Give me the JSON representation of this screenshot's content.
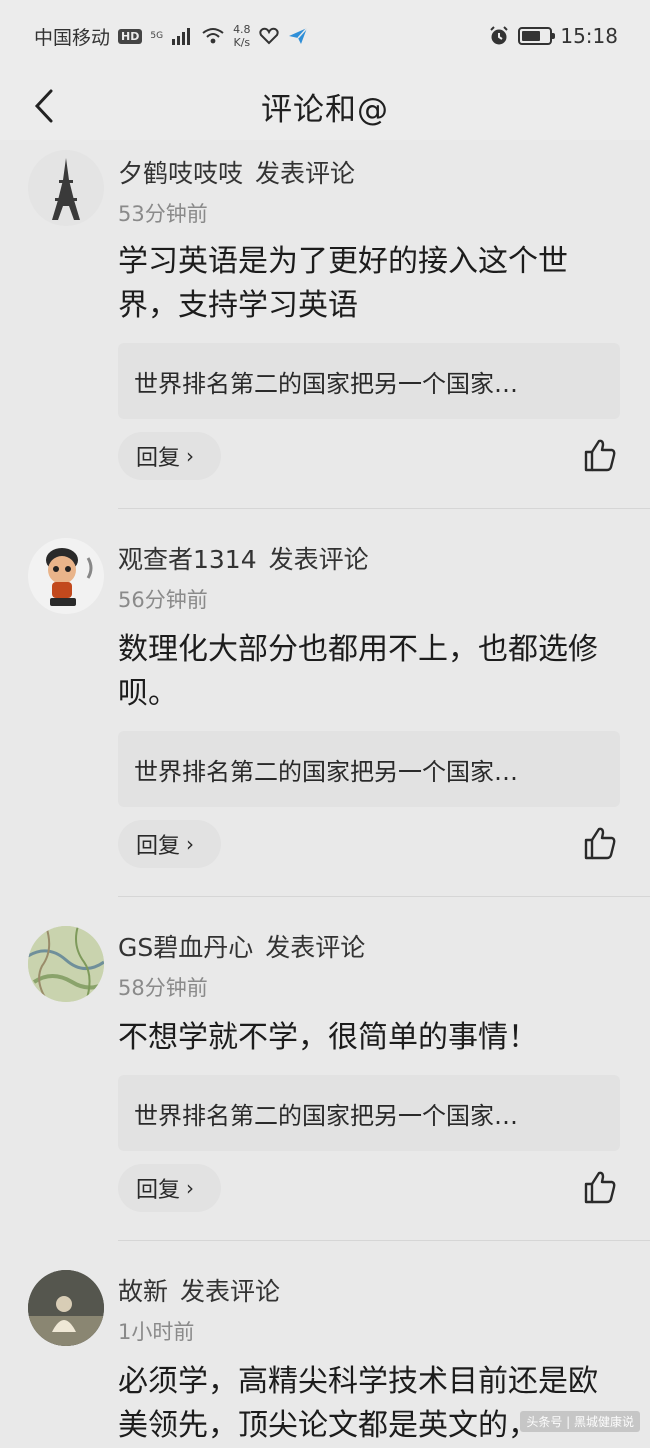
{
  "status_bar": {
    "carrier": "中国移动",
    "hd_tag": "HD",
    "net_mini": "5G",
    "speed_value": "4.8",
    "speed_unit": "K/s",
    "time": "15:18"
  },
  "header": {
    "title": "评论和@"
  },
  "comments": [
    {
      "username": "夕鹤吱吱吱",
      "action": "发表评论",
      "time": "53分钟前",
      "text": "学习英语是为了更好的接入这个世界，支持学习英语",
      "quote": "世界排名第二的国家把另一个国家…",
      "reply_label": "回复"
    },
    {
      "username": "观查者1314",
      "action": "发表评论",
      "time": "56分钟前",
      "text": "数理化大部分也都用不上，也都选修呗。",
      "quote": "世界排名第二的国家把另一个国家…",
      "reply_label": "回复"
    },
    {
      "username": "GS碧血丹心",
      "action": "发表评论",
      "time": "58分钟前",
      "text": "不想学就不学，很简单的事情！",
      "quote": "世界排名第二的国家把另一个国家…",
      "reply_label": "回复"
    },
    {
      "username": "故新",
      "action": "发表评论",
      "time": "1小时前",
      "text": "必须学，高精尖科学技术目前还是欧美领先，顶尖论文都是英文的，",
      "quote": "",
      "reply_label": ""
    }
  ],
  "watermark": "头条号 | 黑城健康说",
  "colors": {
    "background": "#e9e9e9",
    "quote_bg": "#e2e2e2",
    "secondary_text": "#8a8a8a"
  }
}
